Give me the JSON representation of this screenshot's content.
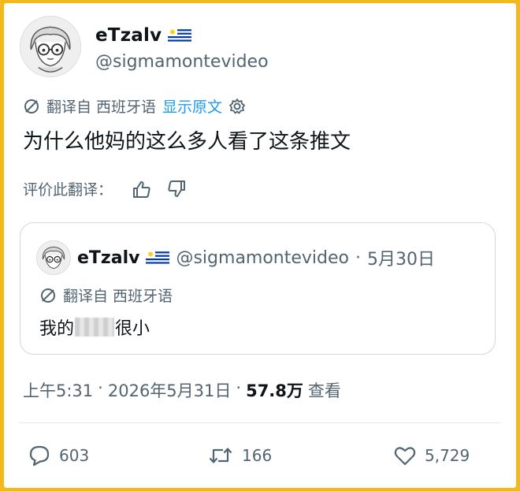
{
  "author": {
    "display_name": "eTzalv",
    "handle": "@sigmamontevideo",
    "flag_icon": "uruguay-flag-icon"
  },
  "translation": {
    "translated_from": "翻译自 西班牙语",
    "show_original": "显示原文",
    "settings_icon": "gear-icon"
  },
  "tweet": {
    "text": "为什么他妈的这么多人看了这条推文"
  },
  "rating": {
    "label": "评价此翻译：",
    "thumbs_up_icon": "thumbs-up-icon",
    "thumbs_down_icon": "thumbs-down-icon"
  },
  "quoted_tweet": {
    "display_name": "eTzalv",
    "handle": "@sigmamontevideo",
    "separator": "·",
    "date": "5月30日",
    "translated_from": "翻译自 西班牙语",
    "text_before": "我的",
    "text_after": "很小"
  },
  "meta": {
    "time": "上午5:31",
    "separator1": "·",
    "date": "2026年5月31日",
    "separator2": "·",
    "views_count": "57.8万",
    "views_label": "查看"
  },
  "actions": {
    "replies": "603",
    "retweets": "166",
    "likes": "5,729"
  },
  "colors": {
    "border": "#f2b81c",
    "link": "#1d9bf0",
    "secondary_text": "#536471",
    "primary_text": "#0f1419"
  }
}
